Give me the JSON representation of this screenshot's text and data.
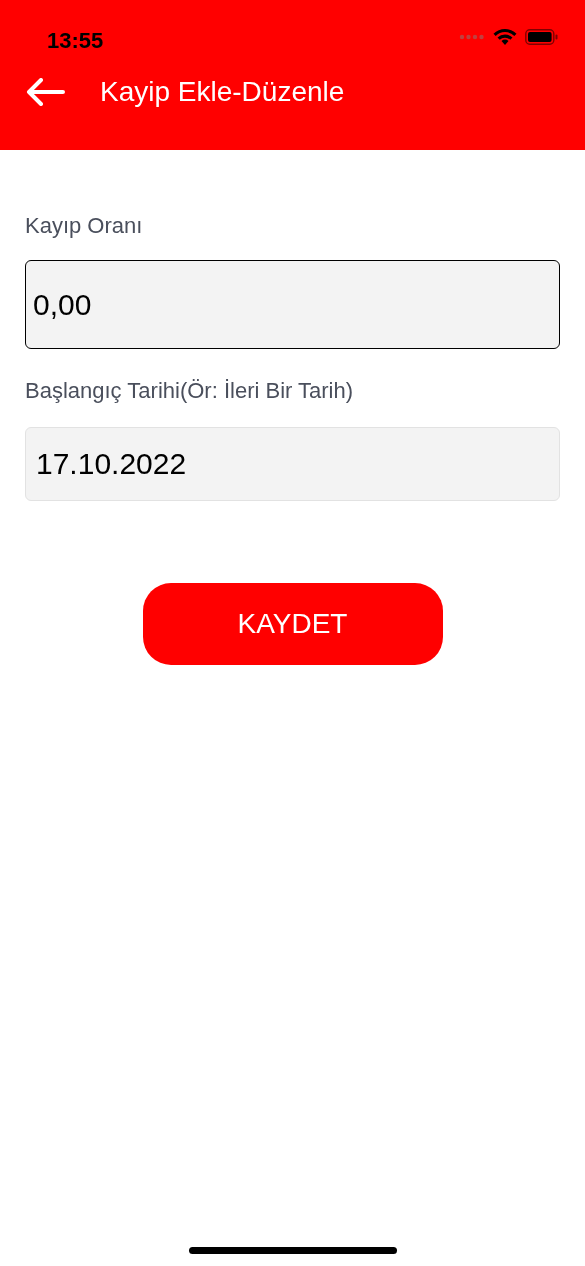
{
  "status_bar": {
    "time": "13:55"
  },
  "header": {
    "title": "Kayip Ekle-Düzenle"
  },
  "fields": [
    {
      "label": "Kayıp Oranı",
      "value": "0,00",
      "focused": true
    },
    {
      "label": "Başlangıç Tarihi(Ör: İleri Bir Tarih)",
      "value": "17.10.2022",
      "focused": false
    }
  ],
  "save_button": {
    "label": "KAYDET"
  }
}
